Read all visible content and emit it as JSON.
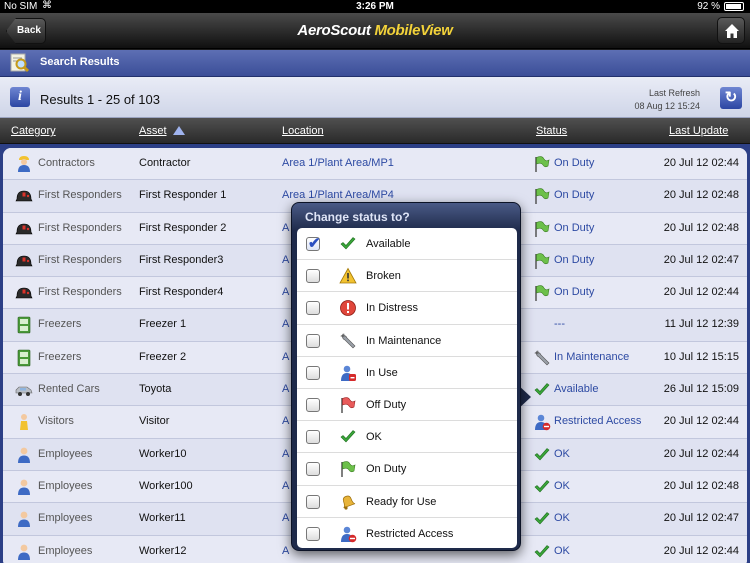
{
  "status_bar": {
    "carrier": "No SIM",
    "time": "3:26 PM",
    "battery": "92 %"
  },
  "nav": {
    "back_label": "Back",
    "title_part1": "AeroScout ",
    "title_part2": "MobileView"
  },
  "section": {
    "title": "Search Results"
  },
  "results": {
    "count_text": "Results 1 - 25 of 103",
    "refresh_label": "Last Refresh",
    "refresh_time": "08 Aug 12 15:24"
  },
  "table": {
    "headers": {
      "category": "Category",
      "asset": "Asset",
      "location": "Location",
      "status": "Status",
      "last_update": "Last Update"
    },
    "rows": [
      {
        "cat_icon": "contractor-icon",
        "category": "Contractors",
        "asset": "Contractor",
        "location": "Area 1/Plant Area/MP1",
        "status_icon": "on-duty-flag-icon",
        "status": "On Duty",
        "updated": "20 Jul 12 02:44"
      },
      {
        "cat_icon": "helmet-icon",
        "category": "First Responders",
        "asset": "First Responder 1",
        "location": "Area 1/Plant Area/MP4",
        "status_icon": "on-duty-flag-icon",
        "status": "On Duty",
        "updated": "20 Jul 12 02:48"
      },
      {
        "cat_icon": "helmet-icon",
        "category": "First Responders",
        "asset": "First Responder 2",
        "location": "A",
        "status_icon": "on-duty-flag-icon",
        "status": "On Duty",
        "updated": "20 Jul 12 02:48"
      },
      {
        "cat_icon": "helmet-icon",
        "category": "First Responders",
        "asset": "First Responder3",
        "location": "A",
        "status_icon": "on-duty-flag-icon",
        "status": "On Duty",
        "updated": "20 Jul 12 02:47"
      },
      {
        "cat_icon": "helmet-icon",
        "category": "First Responders",
        "asset": "First Responder4",
        "location": "A",
        "status_icon": "on-duty-flag-icon",
        "status": "On Duty",
        "updated": "20 Jul 12 02:44"
      },
      {
        "cat_icon": "freezer-icon",
        "category": "Freezers",
        "asset": "Freezer 1",
        "location": "A",
        "status_icon": "",
        "status": "---",
        "updated": "11 Jul 12 12:39"
      },
      {
        "cat_icon": "freezer-icon",
        "category": "Freezers",
        "asset": "Freezer 2",
        "location": "A",
        "status_icon": "wrench-icon",
        "status": "In Maintenance",
        "updated": "10 Jul 12 15:15"
      },
      {
        "cat_icon": "car-icon",
        "category": "Rented Cars",
        "asset": "Toyota",
        "location": "A",
        "status_icon": "check-icon",
        "status": "Available",
        "updated": "26 Jul 12 15:09"
      },
      {
        "cat_icon": "visitor-icon",
        "category": "Visitors",
        "asset": "Visitor",
        "location": "A",
        "status_icon": "restricted-icon",
        "status": "Restricted Access",
        "updated": "20 Jul 12 02:44"
      },
      {
        "cat_icon": "person-icon",
        "category": "Employees",
        "asset": "Worker10",
        "location": "A",
        "status_icon": "check-icon",
        "status": "OK",
        "updated": "20 Jul 12 02:44"
      },
      {
        "cat_icon": "person-icon",
        "category": "Employees",
        "asset": "Worker100",
        "location": "A",
        "status_icon": "check-icon",
        "status": "OK",
        "updated": "20 Jul 12 02:48"
      },
      {
        "cat_icon": "person-icon",
        "category": "Employees",
        "asset": "Worker11",
        "location": "A",
        "status_icon": "check-icon",
        "status": "OK",
        "updated": "20 Jul 12 02:47"
      },
      {
        "cat_icon": "person-icon",
        "category": "Employees",
        "asset": "Worker12",
        "location": "A",
        "status_icon": "check-icon",
        "status": "OK",
        "updated": "20 Jul 12 02:44"
      }
    ]
  },
  "popover": {
    "title": "Change status to?",
    "options": [
      {
        "label": "Available",
        "icon": "check-icon",
        "checked": true
      },
      {
        "label": "Broken",
        "icon": "warning-icon",
        "checked": false
      },
      {
        "label": "In Distress",
        "icon": "distress-icon",
        "checked": false
      },
      {
        "label": "In Maintenance",
        "icon": "wrench-icon",
        "checked": false
      },
      {
        "label": "In Use",
        "icon": "in-use-icon",
        "checked": false
      },
      {
        "label": "Off Duty",
        "icon": "off-duty-flag-icon",
        "checked": false
      },
      {
        "label": "OK",
        "icon": "check-icon",
        "checked": false
      },
      {
        "label": "On Duty",
        "icon": "on-duty-flag-icon",
        "checked": false
      },
      {
        "label": "Ready for Use",
        "icon": "bell-icon",
        "checked": false
      },
      {
        "label": "Restricted Access",
        "icon": "restricted-icon",
        "checked": false
      }
    ]
  }
}
